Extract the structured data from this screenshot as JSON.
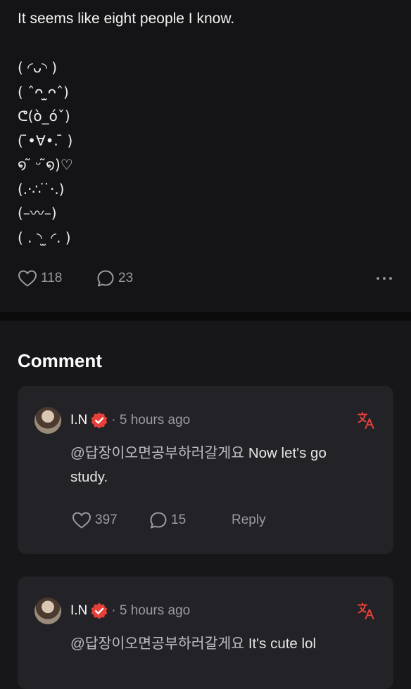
{
  "post": {
    "text": "It seems like eight people I know.",
    "emoticons": [
      "( ◜ᴗ◝ )",
      "( ˆᴖ ̫ᴖˆ)",
      "ᕦ(ò_óˇ)",
      "( ̄•∀•. ̄ )",
      "໑ ̃ ᵕ ̃໑)♡",
      "(.·∴ ̇ ̇·.)",
      "(–〰–)",
      "( . ◝ ̫ ◜. )"
    ],
    "likes": "118",
    "comments": "23"
  },
  "comments_title": "Comment",
  "comments": [
    {
      "username": "I.N",
      "timestamp": "· 5 hours ago",
      "mention": "@답장이오면공부하러갈게요",
      "text": " Now let's go study.",
      "likes": "397",
      "replies": "15",
      "reply_label": "Reply"
    },
    {
      "username": "I.N",
      "timestamp": "· 5 hours ago",
      "mention": "@답장이오면공부하러갈게요",
      "text": " It's cute lol"
    }
  ],
  "icons": {
    "like": "heart-outline-icon",
    "comment": "speech-bubble-icon",
    "more": "ellipsis-icon",
    "verified": "verified-badge-icon",
    "translate": "translate-icon"
  },
  "colors": {
    "background": "#141416",
    "card": "#232327",
    "accent_red": "#e5413a",
    "muted_text": "#9b9ba0"
  }
}
